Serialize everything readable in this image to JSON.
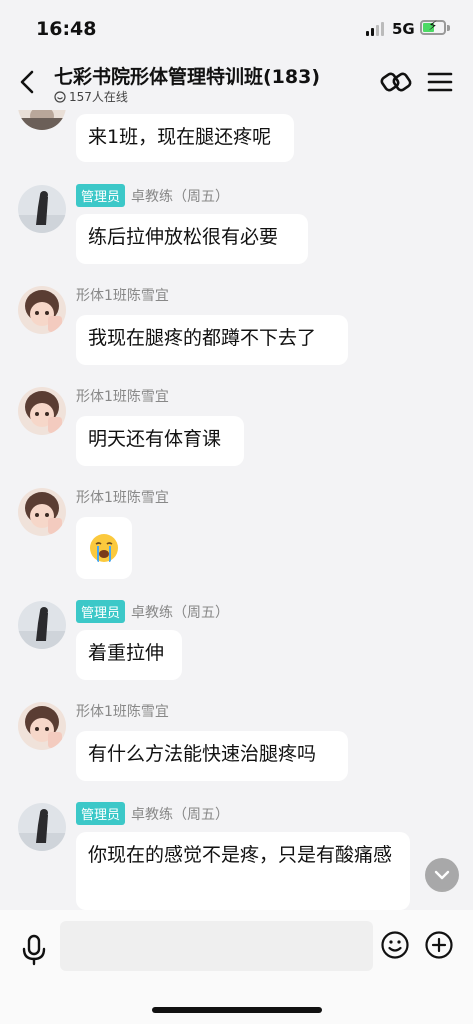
{
  "status_bar": {
    "time": "16:48",
    "network": "5G"
  },
  "header": {
    "title": "七彩书院形体管理特训班(183)",
    "online": "157人在线"
  },
  "messages": [
    {
      "sender": "",
      "text": "来1班，现在腿还疼呢"
    },
    {
      "sender": "卓教练（周五）",
      "role": "管理员",
      "text": "练后拉伸放松很有必要"
    },
    {
      "sender": "形体1班陈雪宜",
      "text": "我现在腿疼的都蹲不下去了"
    },
    {
      "sender": "形体1班陈雪宜",
      "text": "明天还有体育课"
    },
    {
      "sender": "形体1班陈雪宜",
      "text": "😭"
    },
    {
      "sender": "卓教练（周五）",
      "role": "管理员",
      "text": "着重拉伸"
    },
    {
      "sender": "形体1班陈雪宜",
      "text": "有什么方法能快速治腿疼吗"
    },
    {
      "sender": "卓教练（周五）",
      "role": "管理员",
      "text": "你现在的感觉不是疼，只是有酸痛感"
    }
  ],
  "input": {
    "placeholder": ""
  },
  "colors": {
    "admin_badge": "#3cc8c8",
    "background": "#f3f3f5",
    "bubble": "#ffffff"
  }
}
